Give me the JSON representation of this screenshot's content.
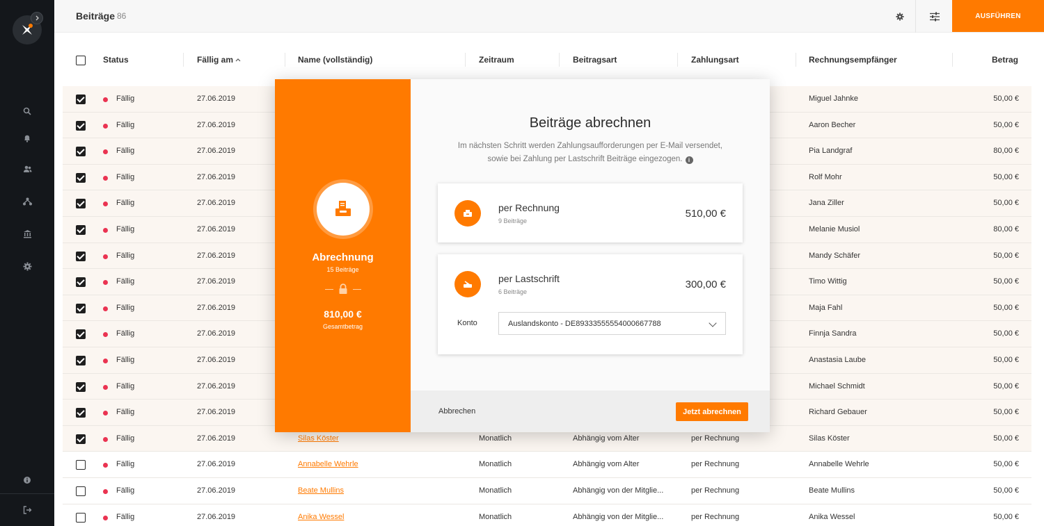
{
  "header": {
    "title": "Beiträge",
    "count": "86",
    "run_button": "AUSFÜHREN"
  },
  "table": {
    "columns": {
      "status": "Status",
      "due": "Fällig am",
      "name": "Name (vollständig)",
      "period": "Zeitraum",
      "type": "Beitragsart",
      "payment": "Zahlungsart",
      "recipient": "Rechnungsempfänger",
      "amount": "Betrag"
    },
    "rows": [
      {
        "checked": true,
        "status": "Fällig",
        "date": "27.06.2019",
        "name": "",
        "period": "",
        "type": "",
        "payment": "",
        "recipient": "Miguel Jahnke",
        "amount": "50,00 €"
      },
      {
        "checked": true,
        "status": "Fällig",
        "date": "27.06.2019",
        "name": "",
        "period": "",
        "type": "",
        "payment": "",
        "recipient": "Aaron Becher",
        "amount": "50,00 €"
      },
      {
        "checked": true,
        "status": "Fällig",
        "date": "27.06.2019",
        "name": "",
        "period": "",
        "type": "",
        "payment": "",
        "recipient": "Pia Landgraf",
        "amount": "80,00 €"
      },
      {
        "checked": true,
        "status": "Fällig",
        "date": "27.06.2019",
        "name": "",
        "period": "",
        "type": "",
        "payment": "",
        "recipient": "Rolf Mohr",
        "amount": "50,00 €"
      },
      {
        "checked": true,
        "status": "Fällig",
        "date": "27.06.2019",
        "name": "",
        "period": "",
        "type": "",
        "payment": "",
        "recipient": "Jana Ziller",
        "amount": "50,00 €"
      },
      {
        "checked": true,
        "status": "Fällig",
        "date": "27.06.2019",
        "name": "",
        "period": "",
        "type": "",
        "payment": "",
        "recipient": "Melanie Musiol",
        "amount": "80,00 €"
      },
      {
        "checked": true,
        "status": "Fällig",
        "date": "27.06.2019",
        "name": "",
        "period": "",
        "type": "",
        "payment": "",
        "recipient": "Mandy Schäfer",
        "amount": "50,00 €"
      },
      {
        "checked": true,
        "status": "Fällig",
        "date": "27.06.2019",
        "name": "",
        "period": "",
        "type": "",
        "payment": "",
        "recipient": "Timo Wittig",
        "amount": "50,00 €"
      },
      {
        "checked": true,
        "status": "Fällig",
        "date": "27.06.2019",
        "name": "",
        "period": "",
        "type": "",
        "payment": "",
        "recipient": "Maja Fahl",
        "amount": "50,00 €"
      },
      {
        "checked": true,
        "status": "Fällig",
        "date": "27.06.2019",
        "name": "",
        "period": "",
        "type": "",
        "payment": "",
        "recipient": "Finnja Sandra",
        "amount": "50,00 €"
      },
      {
        "checked": true,
        "status": "Fällig",
        "date": "27.06.2019",
        "name": "",
        "period": "",
        "type": "",
        "payment": "",
        "recipient": "Anastasia Laube",
        "amount": "50,00 €"
      },
      {
        "checked": true,
        "status": "Fällig",
        "date": "27.06.2019",
        "name": "",
        "period": "",
        "type": "",
        "payment": "",
        "recipient": "Michael Schmidt",
        "amount": "50,00 €"
      },
      {
        "checked": true,
        "status": "Fällig",
        "date": "27.06.2019",
        "name": "",
        "period": "",
        "type": "",
        "payment": "",
        "recipient": "Richard Gebauer",
        "amount": "50,00 €"
      },
      {
        "checked": true,
        "status": "Fällig",
        "date": "27.06.2019",
        "name": "Silas Köster",
        "period": "Monatlich",
        "type": "Abhängig vom Alter",
        "payment": "per Rechnung",
        "recipient": "Silas Köster",
        "amount": "50,00 €"
      },
      {
        "checked": false,
        "status": "Fällig",
        "date": "27.06.2019",
        "name": "Annabelle Wehrle",
        "period": "Monatlich",
        "type": "Abhängig vom Alter",
        "payment": "per Rechnung",
        "recipient": "Annabelle Wehrle",
        "amount": "50,00 €"
      },
      {
        "checked": false,
        "status": "Fällig",
        "date": "27.06.2019",
        "name": "Beate Mullins",
        "period": "Monatlich",
        "type": "Abhängig von der Mitglie...",
        "payment": "per Rechnung",
        "recipient": "Beate Mullins",
        "amount": "50,00 €"
      },
      {
        "checked": false,
        "status": "Fällig",
        "date": "27.06.2019",
        "name": "Anika Wessel",
        "period": "Monatlich",
        "type": "Abhängig von der Mitglie...",
        "payment": "per Rechnung",
        "recipient": "Anika Wessel",
        "amount": "50,00 €"
      }
    ]
  },
  "modal": {
    "left": {
      "title": "Abrechnung",
      "subtitle": "15 Beiträge",
      "amount": "810,00 €",
      "amount_label": "Gesamtbetrag"
    },
    "title": "Beiträge abrechnen",
    "description_line1": "Im nächsten Schritt werden Zahlungsaufforderungen per E-Mail versendet,",
    "description_line2": "sowie bei Zahlung per Lastschrift Beiträge eingezogen.",
    "invoice": {
      "title": "per Rechnung",
      "subtitle": "9 Beiträge",
      "amount": "510,00 €"
    },
    "debit": {
      "title": "per Lastschrift",
      "subtitle": "6 Beiträge",
      "amount": "300,00 €",
      "account_label": "Konto",
      "account_value": "Auslandskonto - DE89333555554000667788"
    },
    "cancel": "Abbrechen",
    "submit": "Jetzt abrechnen"
  },
  "colors": {
    "accent": "#ff7a00",
    "sidebar": "#14171b",
    "status_due": "#ea3351"
  }
}
